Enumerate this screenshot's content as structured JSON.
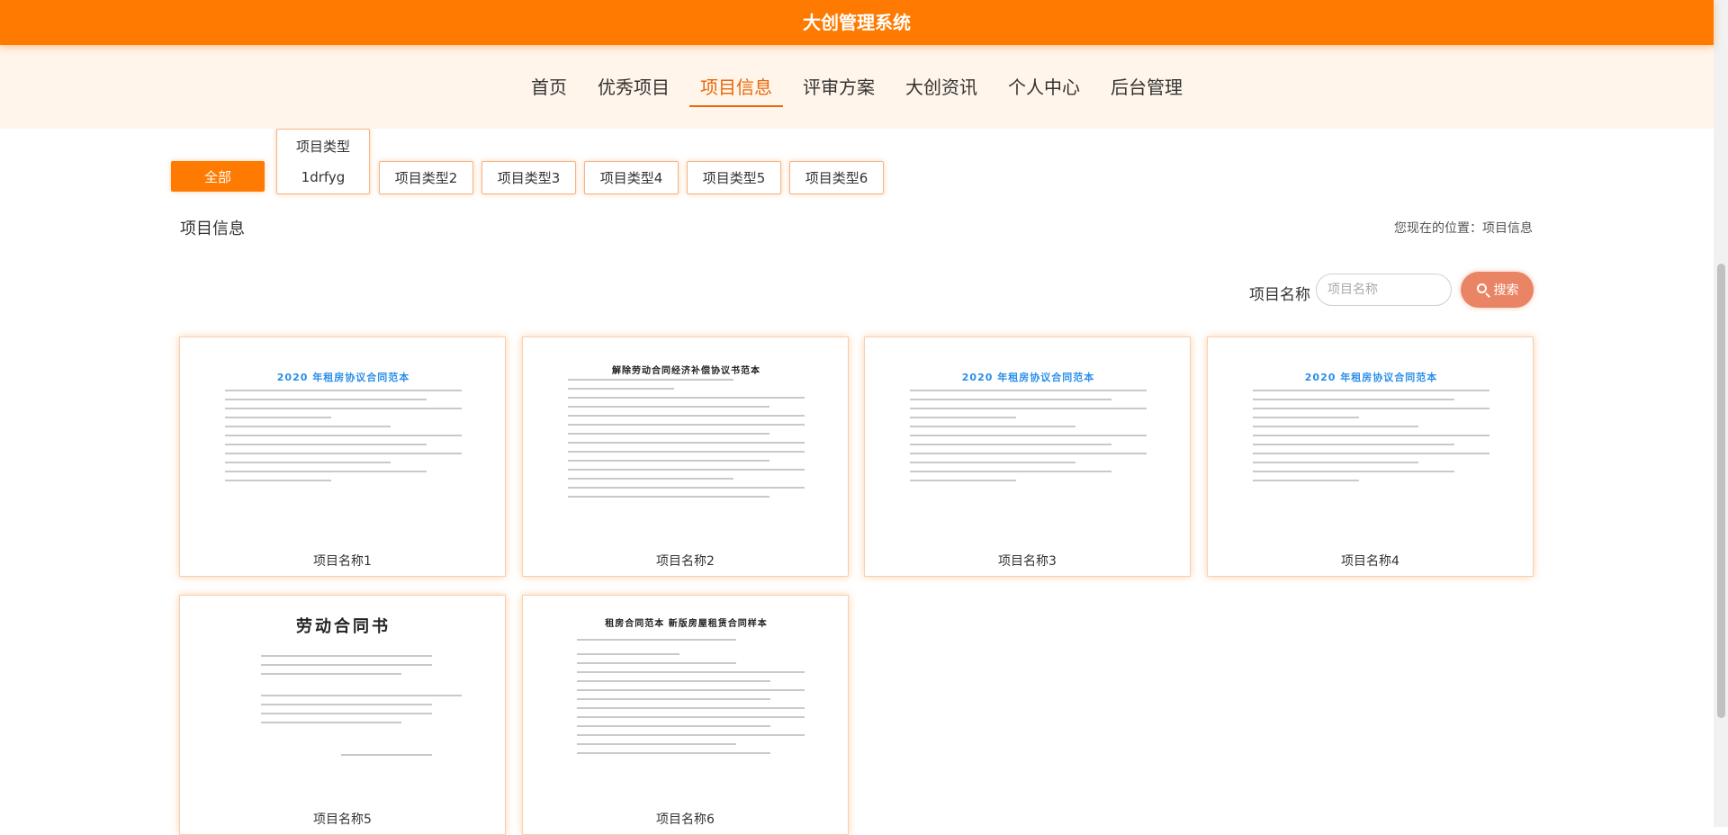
{
  "header": {
    "title": "大创管理系统"
  },
  "nav": [
    {
      "label": "首页"
    },
    {
      "label": "优秀项目"
    },
    {
      "label": "项目信息",
      "active": true
    },
    {
      "label": "评审方案"
    },
    {
      "label": "大创资讯"
    },
    {
      "label": "个人中心"
    },
    {
      "label": "后台管理"
    }
  ],
  "filters": {
    "all": "全部",
    "type1_line1": "项目类型",
    "type1_line2": "1drfyg",
    "type2": "项目类型2",
    "type3": "项目类型3",
    "type4": "项目类型4",
    "type5": "项目类型5",
    "type6": "项目类型6"
  },
  "section": {
    "title": "项目信息",
    "breadcrumb": "您现在的位置：项目信息"
  },
  "search": {
    "label": "项目名称",
    "placeholder": "项目名称",
    "button": "搜索"
  },
  "cards": [
    {
      "name": "项目名称1",
      "doc_title": "2020 年租房协议合同范本"
    },
    {
      "name": "项目名称2",
      "doc_title": "解除劳动合同经济补偿协议书范本"
    },
    {
      "name": "项目名称3",
      "doc_title": "2020 年租房协议合同范本"
    },
    {
      "name": "项目名称4",
      "doc_title": "2020 年租房协议合同范本"
    },
    {
      "name": "项目名称5",
      "doc_title": "劳动合同书"
    },
    {
      "name": "项目名称6",
      "doc_title": "租房合同范本 新版房屋租赁合同样本"
    }
  ],
  "colors": {
    "brand": "#ff7a00",
    "nav_bg": "#fff5ea",
    "search_button": "#e98564",
    "doc_blue": "#2b8ee8"
  }
}
